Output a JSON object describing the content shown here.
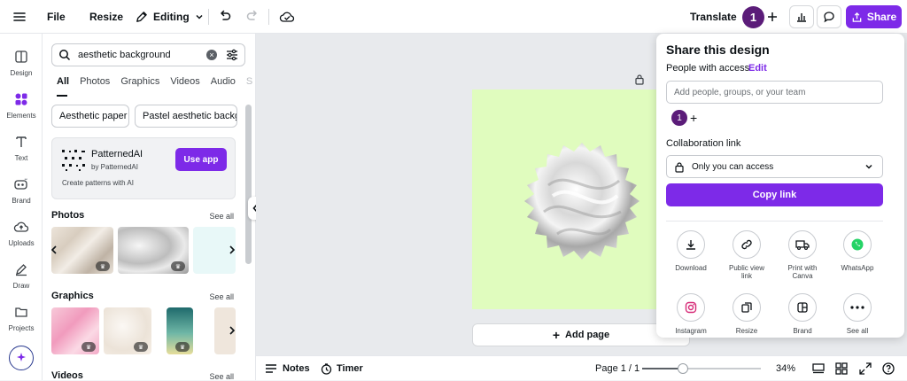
{
  "topbar": {
    "file": "File",
    "resize": "Resize",
    "editing": "Editing",
    "translate": "Translate",
    "avatar": "1",
    "share": "Share"
  },
  "rail": [
    {
      "label": "Design"
    },
    {
      "label": "Elements"
    },
    {
      "label": "Text"
    },
    {
      "label": "Brand"
    },
    {
      "label": "Uploads"
    },
    {
      "label": "Draw"
    },
    {
      "label": "Projects"
    }
  ],
  "search": {
    "value": "aesthetic background"
  },
  "tabs": [
    "All",
    "Photos",
    "Graphics",
    "Videos",
    "Audio",
    "S"
  ],
  "chips": [
    "Aesthetic paper",
    "Pastel aesthetic backgr"
  ],
  "promo": {
    "title": "PatternedAI",
    "by": "by PatternedAI",
    "desc": "Create patterns with AI",
    "button": "Use app"
  },
  "sections": {
    "photos": "Photos",
    "graphics": "Graphics",
    "videos": "Videos",
    "see_all": "See all"
  },
  "canvas": {
    "add_page": "Add page"
  },
  "bottombar": {
    "notes": "Notes",
    "timer": "Timer",
    "page": "Page 1 / 1",
    "zoom": "34%",
    "zoom_level": 0.34
  },
  "share": {
    "title": "Share this design",
    "people": "People with access",
    "edit": "Edit",
    "input_placeholder": "Add people, groups, or your team",
    "avatar": "1",
    "collab": "Collaboration link",
    "access": "Only you can access",
    "copy": "Copy link",
    "options": [
      {
        "label": "Download",
        "icon": "download-icon"
      },
      {
        "label": "Public view link",
        "icon": "link-icon"
      },
      {
        "label": "Print with Canva",
        "icon": "truck-icon"
      },
      {
        "label": "WhatsApp",
        "icon": "whatsapp-icon"
      },
      {
        "label": "Instagram",
        "icon": "instagram-icon"
      },
      {
        "label": "Resize",
        "icon": "resize-icon"
      },
      {
        "label": "Brand",
        "icon": "brand-icon"
      },
      {
        "label": "See all",
        "icon": "more-icon"
      }
    ]
  },
  "colors": {
    "accent": "#7d2ae8",
    "avatar": "#5b1c79",
    "page_bg": "#e0fcbe",
    "whatsapp": "#25d366"
  }
}
